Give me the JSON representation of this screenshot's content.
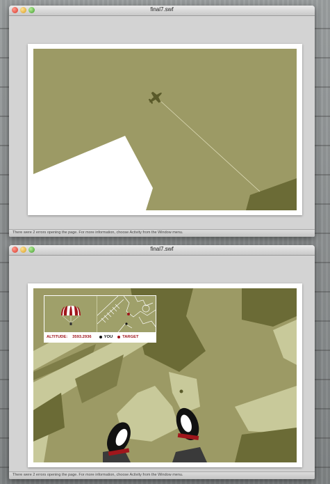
{
  "windows": [
    {
      "title": "final7.swf",
      "status": "There were 2 errors opening the page. For more information, choose Activity from the Window menu."
    },
    {
      "title": "final7.swf",
      "status": "There were 2 errors opening the page. For more information, choose Activity from the Window menu."
    }
  ],
  "hud": {
    "altitude_label": "ALTITUDE:",
    "altitude_value": "3593.2936",
    "legend_you": "YOU",
    "legend_target": "TARGET"
  },
  "colors": {
    "olive": "#9c9a65",
    "olive_dark": "#6b6b36",
    "olive_light": "#c8c99a",
    "olive_mid": "#7e7d48",
    "accent_red": "#a0161c"
  },
  "icons": {
    "close": "close-light-icon",
    "minimize": "minimize-light-icon",
    "zoom": "zoom-light-icon",
    "plane": "airplane-icon",
    "balloon": "parachute-balloon-icon"
  }
}
